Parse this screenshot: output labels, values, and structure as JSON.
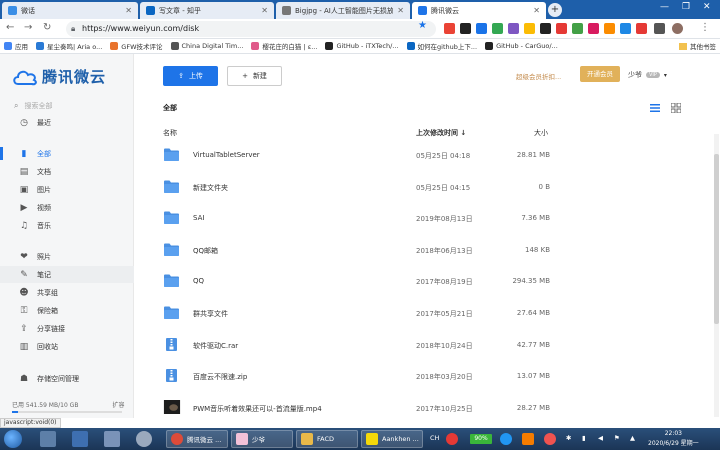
{
  "browser": {
    "tabs": [
      {
        "label": "微话",
        "color": "#3a8ee6"
      },
      {
        "label": "写文章 - 知乎",
        "color": "#0a66c2"
      },
      {
        "label": "Bigjpg - AI人工智能图片无损放大",
        "color": "#777777"
      },
      {
        "label": "腾讯微云",
        "color": "#1e74e8"
      }
    ],
    "url": "https://www.weiyun.com/disk",
    "bookmarks": [
      {
        "label": "应用",
        "color": "#4285f4"
      },
      {
        "label": "星尘奏鸣| Aria o...",
        "color": "#2a7ad5"
      },
      {
        "label": "GFW技术评论",
        "color": "#e8732c"
      },
      {
        "label": "China Digital Tim...",
        "color": "#555555"
      },
      {
        "label": "樱花庄的白猫 | ε...",
        "color": "#e05a8a"
      },
      {
        "label": "GitHub - iTXTech/...",
        "color": "#222222"
      },
      {
        "label": "如何在github上下...",
        "color": "#0a66c2"
      },
      {
        "label": "GitHub - CarGuo/...",
        "color": "#222222"
      }
    ],
    "other_bookmarks": "其他书签",
    "status_url": "javascript:void(0)"
  },
  "app": {
    "logo_text": "腾讯微云",
    "search_placeholder": "搜索全部",
    "nav": [
      {
        "label": "最近",
        "icon": "clock-icon",
        "glyph": "◷"
      },
      {
        "label": "全部",
        "icon": "all-files-icon",
        "glyph": "▮"
      },
      {
        "label": "文档",
        "icon": "document-icon",
        "glyph": "▤"
      },
      {
        "label": "图片",
        "icon": "image-icon",
        "glyph": "▣"
      },
      {
        "label": "视频",
        "icon": "video-icon",
        "glyph": "▶"
      },
      {
        "label": "音乐",
        "icon": "music-icon",
        "glyph": "♫"
      },
      {
        "label": "照片",
        "icon": "photo-icon",
        "glyph": "❤"
      },
      {
        "label": "笔记",
        "icon": "note-icon",
        "glyph": "✎"
      },
      {
        "label": "共享组",
        "icon": "group-icon",
        "glyph": "☻"
      },
      {
        "label": "保险箱",
        "icon": "safe-icon",
        "glyph": "⚿"
      },
      {
        "label": "分享链接",
        "icon": "share-link-icon",
        "glyph": "⇪"
      },
      {
        "label": "回收站",
        "icon": "recycle-bin-icon",
        "glyph": "▥"
      },
      {
        "label": "存储空间管理",
        "icon": "storage-icon",
        "glyph": "☗"
      }
    ],
    "storage": {
      "text": "已用 541.59 MB/10 GB",
      "expand": "扩容",
      "used_fraction": 0.05
    },
    "toolbar": {
      "upload": "上传",
      "new": "新建",
      "vip_link": "超级会员折扣...",
      "vip_button": "开通会员",
      "user": "少爷",
      "user_badge": "VIP"
    },
    "breadcrumb": "全部",
    "columns": {
      "name": "名称",
      "date": "上次修改时间 ↓",
      "size": "大小"
    },
    "files": [
      {
        "name": "VirtualTabletServer",
        "date": "05月25日 04:18",
        "size": "28.81 MB",
        "type": "folder"
      },
      {
        "name": "新建文件夹",
        "date": "05月25日 04:15",
        "size": "0 B",
        "type": "folder"
      },
      {
        "name": "SAI",
        "date": "2019年08月13日",
        "size": "7.36 MB",
        "type": "folder"
      },
      {
        "name": "QQ邮箱",
        "date": "2018年06月13日",
        "size": "148 KB",
        "type": "folder"
      },
      {
        "name": "QQ",
        "date": "2017年08月19日",
        "size": "294.35 MB",
        "type": "folder"
      },
      {
        "name": "群共享文件",
        "date": "2017年05月21日",
        "size": "27.64 MB",
        "type": "folder"
      },
      {
        "name": "软件驱动C.rar",
        "date": "2018年10月24日",
        "size": "42.77 MB",
        "type": "archive"
      },
      {
        "name": "百度云不限速.zip",
        "date": "2018年03月20日",
        "size": "13.07 MB",
        "type": "archive"
      },
      {
        "name": "PWM音乐听着效果还可以-首流量版.mp4",
        "date": "2017年10月25日",
        "size": "28.27 MB",
        "type": "video"
      }
    ]
  },
  "taskbar": {
    "items": [
      {
        "label": "腾讯微云 ...",
        "color": "#dd4b39"
      },
      {
        "label": "少爷",
        "color": "#f3c1d8"
      },
      {
        "label": "FACD",
        "color": "#e9b949"
      },
      {
        "label": "Aankhen ...",
        "color": "#f5d90a"
      }
    ],
    "ime": "CH",
    "battery": "90%",
    "clock_time": "22:03",
    "clock_date": "2020/6/29 星期一"
  }
}
